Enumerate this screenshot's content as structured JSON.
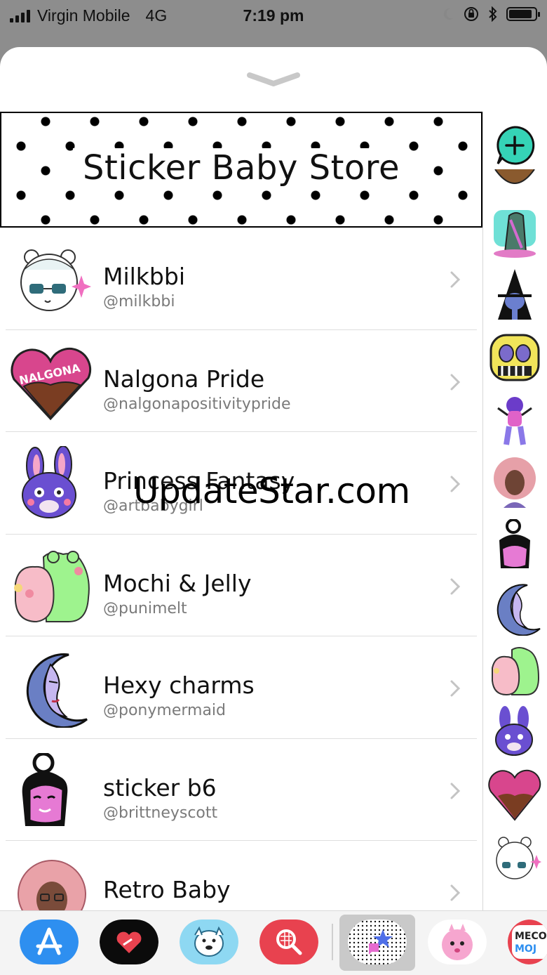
{
  "status_bar": {
    "carrier": "Virgin Mobile",
    "network": "4G",
    "time": "7:19 pm"
  },
  "store": {
    "banner_title": "Sticker Baby Store"
  },
  "list": [
    {
      "name": "Milkbbi",
      "handle": "@milkbbi",
      "icon": "milkbbi-sticker-icon"
    },
    {
      "name": "Nalgona Pride",
      "handle": "@nalgonapositivitypride",
      "icon": "heart-sticker-icon"
    },
    {
      "name": "Princess Fantasy",
      "handle": "@artbabygirl",
      "icon": "bunny-sticker-icon"
    },
    {
      "name": "Mochi & Jelly",
      "handle": "@punimelt",
      "icon": "mochi-jelly-sticker-icon"
    },
    {
      "name": "Hexy charms",
      "handle": "@ponymermaid",
      "icon": "moon-sticker-icon"
    },
    {
      "name": "sticker b6",
      "handle": "@brittneyscott",
      "icon": "girl-sticker-icon"
    },
    {
      "name": "Retro Baby",
      "handle": "",
      "icon": "retro-baby-sticker-icon"
    }
  ],
  "watermark": "UpdateStar.com",
  "rail": {
    "add_icon": "add-sticker-icon",
    "items": [
      "crystal-icon",
      "witch-icon",
      "skull-icon",
      "dancer-icon",
      "curly-girl-icon",
      "bun-girl-icon",
      "moon-icon",
      "mochi-icon",
      "bunny-icon",
      "heart-icon",
      "milkbbi-icon"
    ]
  },
  "dock": {
    "apps": [
      "app-store-icon",
      "heart-app-icon",
      "dog-app-icon",
      "search-app-icon",
      "sticker-baby-app-icon",
      "pink-blob-app-icon",
      "meco-moji-app-icon"
    ],
    "meco_label": "MECO MOJ"
  },
  "colors": {
    "accent_teal": "#35d3b6",
    "app_store_blue": "#2e8ff0",
    "red": "#e8424f"
  }
}
